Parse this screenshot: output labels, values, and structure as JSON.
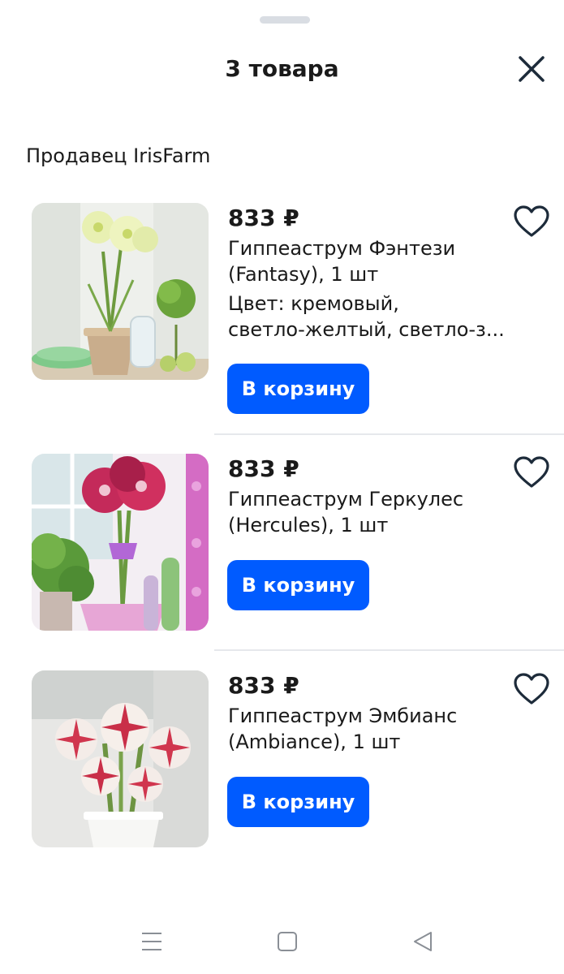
{
  "header": {
    "title": "3 товара"
  },
  "seller": {
    "label": "Продавец IrisFarm"
  },
  "items": [
    {
      "price": "833 ₽",
      "name_line1": "Гиппеаструм Фэнтези",
      "name_line2": "(Fantasy), 1 шт",
      "attr_line1": "Цвет: кремовый,",
      "attr_line2": "светло-желтый, светло-з...",
      "cart_label": "В корзину",
      "image": "photo of pale yellow amaryllis in pot"
    },
    {
      "price": "833 ₽",
      "name_line1": "Гиппеаструм Геркулес",
      "name_line2": "(Hercules), 1 шт",
      "cart_label": "В корзину",
      "image": "photo of pink-red amaryllis in pot"
    },
    {
      "price": "833 ₽",
      "name_line1": "Гиппеаструм Эмбианс",
      "name_line2": "(Ambiance), 1 шт",
      "cart_label": "В корзину",
      "image": "photo of red and white striped amaryllis"
    }
  ],
  "icons": {
    "close": "close-icon",
    "favorite": "heart-outline-icon",
    "nav_menu": "menu-icon",
    "nav_home": "square-icon",
    "nav_back": "back-triangle-icon"
  },
  "colors": {
    "accent": "#005bff",
    "text": "#1a1a1a",
    "icon": "#1d2b3a",
    "divider": "#e6e8ec"
  }
}
